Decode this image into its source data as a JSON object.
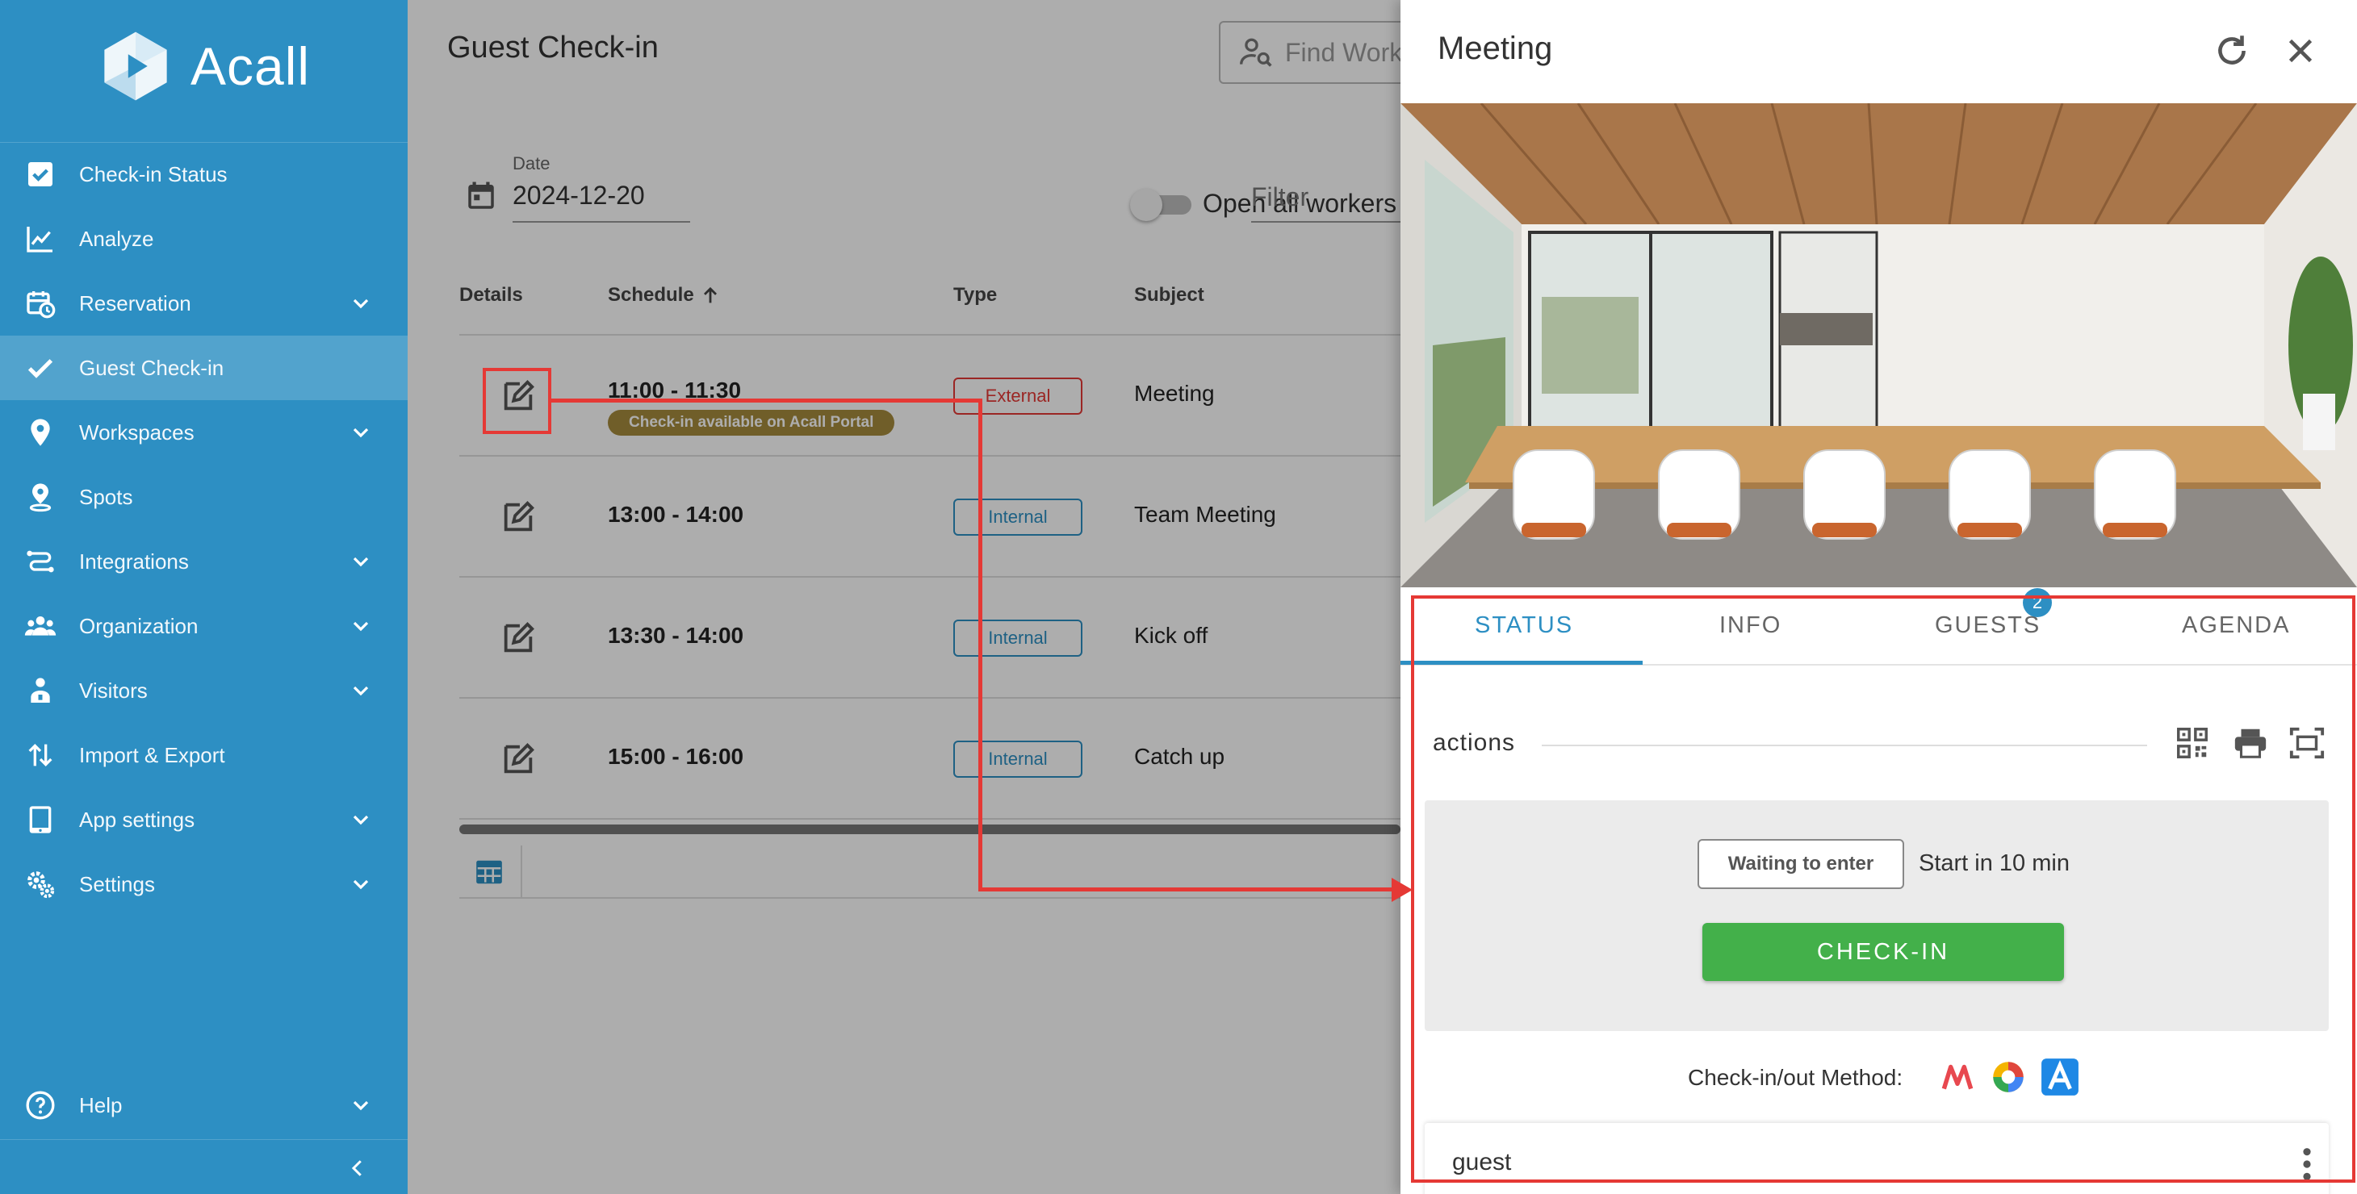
{
  "app": {
    "name": "Acall"
  },
  "sidebar": {
    "items": [
      {
        "label": "Check-in Status",
        "icon": "check-square-icon",
        "expandable": false
      },
      {
        "label": "Analyze",
        "icon": "line-chart-icon",
        "expandable": false
      },
      {
        "label": "Reservation",
        "icon": "calendar-clock-icon",
        "expandable": true
      },
      {
        "label": "Guest Check-in",
        "icon": "checkmark-icon",
        "expandable": false,
        "active": true
      },
      {
        "label": "Workspaces",
        "icon": "map-pin-icon",
        "expandable": true
      },
      {
        "label": "Spots",
        "icon": "person-pin-icon",
        "expandable": false
      },
      {
        "label": "Integrations",
        "icon": "integration-icon",
        "expandable": true
      },
      {
        "label": "Organization",
        "icon": "people-icon",
        "expandable": true
      },
      {
        "label": "Visitors",
        "icon": "visitor-icon",
        "expandable": true
      },
      {
        "label": "Import & Export",
        "icon": "import-export-icon",
        "expandable": false
      },
      {
        "label": "App settings",
        "icon": "tablet-icon",
        "expandable": true
      },
      {
        "label": "Settings",
        "icon": "gear-icon",
        "expandable": true
      }
    ],
    "help": {
      "label": "Help",
      "icon": "help-circle-icon"
    }
  },
  "main": {
    "title": "Guest Check-in",
    "search_placeholder": "Find Work",
    "date_label": "Date",
    "date_value": "2024-12-20",
    "toggle_label": "Open all workers and guests",
    "toggle_on": false,
    "filter_placeholder": "Filter",
    "table": {
      "headers": {
        "details": "Details",
        "schedule": "Schedule",
        "type": "Type",
        "subject": "Subject"
      },
      "sort": "schedule-ascending",
      "rows": [
        {
          "time": "11:00 - 11:30",
          "note": "Check-in available on Acall Portal",
          "type": "External",
          "subject": "Meeting"
        },
        {
          "time": "13:00 - 14:00",
          "note": "",
          "type": "Internal",
          "subject": "Team Meeting"
        },
        {
          "time": "13:30 - 14:00",
          "note": "",
          "type": "Internal",
          "subject": "Kick off"
        },
        {
          "time": "15:00 - 16:00",
          "note": "",
          "type": "Internal",
          "subject": "Catch up"
        }
      ]
    }
  },
  "drawer": {
    "title": "Meeting",
    "tabs": [
      "STATUS",
      "INFO",
      "GUESTS",
      "AGENDA"
    ],
    "active_tab": "STATUS",
    "guests_badge": "2",
    "actions_label": "actions",
    "status_chip": "Waiting to enter",
    "start_text": "Start in 10 min",
    "checkin_button": "CHECK-IN",
    "method_label": "Check-in/out Method:",
    "guest_label": "guest"
  },
  "colors": {
    "sidebar": "#2d8fc3",
    "accent": "#2d8fc3",
    "external": "#e53935",
    "checkin": "#43b04a",
    "badge_bg": "#a68b3d",
    "annotation": "#e53935"
  }
}
